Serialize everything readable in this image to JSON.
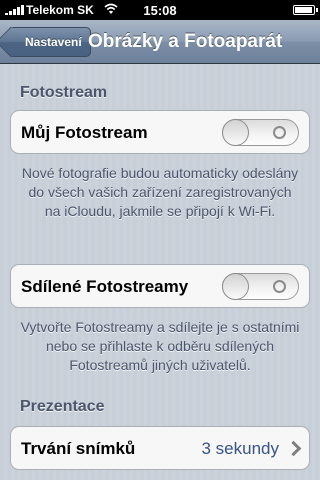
{
  "status_bar": {
    "carrier": "Telekom SK",
    "time": "15:08",
    "signal_bars": 5,
    "battery_level": 0.9
  },
  "nav": {
    "back_label": "Nastavení",
    "title": "Obrázky a Fotoaparát"
  },
  "sections": {
    "fotostream": {
      "header": "Fotostream",
      "my_photostream": {
        "label": "Můj Fotostream",
        "enabled": false,
        "footnote": "Nové fotografie budou automaticky odeslány do všech vašich zařízení zaregistrovaných na iCloudu, jakmile se připojí k Wi-Fi."
      },
      "shared_photostreams": {
        "label": "Sdílené Fotostreamy",
        "enabled": false,
        "footnote": "Vytvořte Fotostreamy a sdílejte je s ostatními nebo se přihlaste k odběru sdílených Fotostreamů jiných uživatelů."
      }
    },
    "prezentace": {
      "header": "Prezentace",
      "slide_duration": {
        "label": "Trvání snímků",
        "value": "3 sekundy"
      }
    }
  },
  "colors": {
    "nav_bar": "#7d8fa6",
    "value_text": "#385487",
    "section_header_text": "#4c566c"
  }
}
